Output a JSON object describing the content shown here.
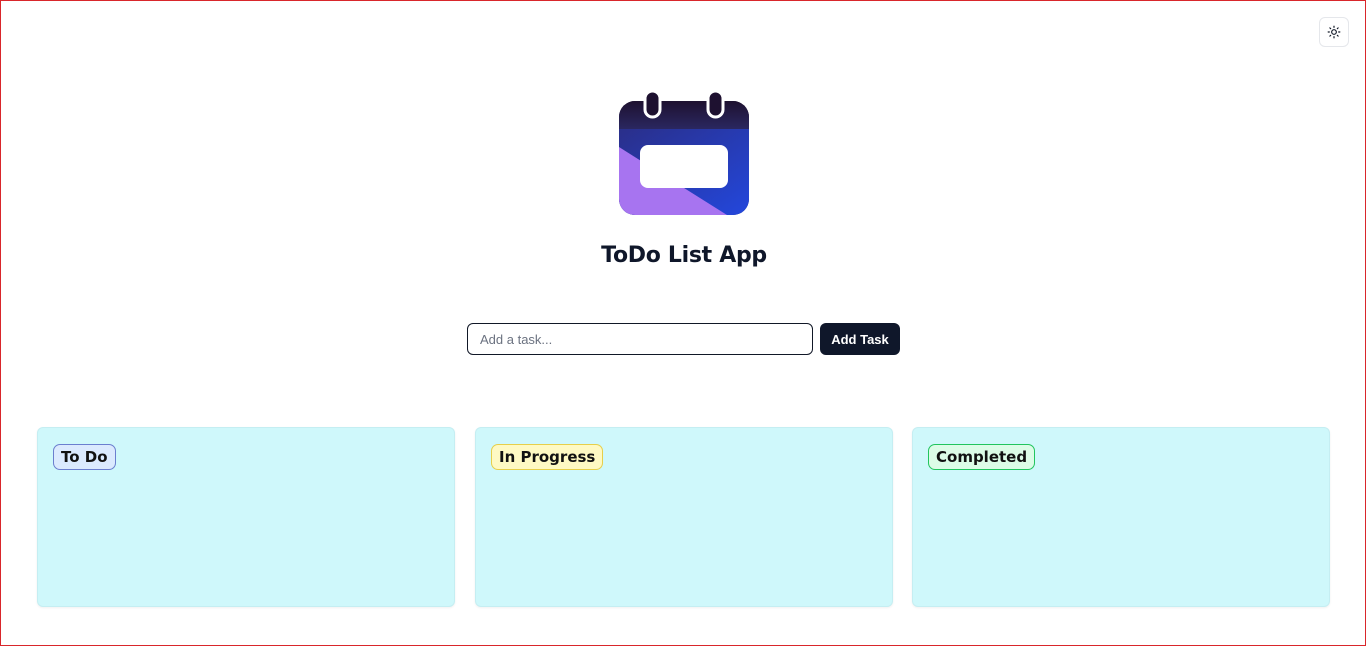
{
  "header": {
    "theme_toggle_icon": "sun-icon"
  },
  "logo": {
    "icon": "calendar-icon",
    "colors": {
      "top_dark": "#1e1130",
      "blue": "#2a46d8",
      "purple": "#a774f0"
    }
  },
  "app": {
    "title": "ToDo List App"
  },
  "task_form": {
    "input_value": "",
    "input_placeholder": "Add a task...",
    "add_button_label": "Add Task"
  },
  "columns": [
    {
      "label": "To Do",
      "badge_bg": "#dbeafe",
      "badge_border": "#6b7fcf",
      "tasks": []
    },
    {
      "label": "In Progress",
      "badge_bg": "#fef9c3",
      "badge_border": "#e6cf4a",
      "tasks": []
    },
    {
      "label": "Completed",
      "badge_bg": "#dcfce7",
      "badge_border": "#22c55e",
      "tasks": []
    }
  ],
  "colors": {
    "column_bg": "#cff8fb",
    "button_bg": "#0f172a",
    "frame_border": "#d9262b"
  }
}
